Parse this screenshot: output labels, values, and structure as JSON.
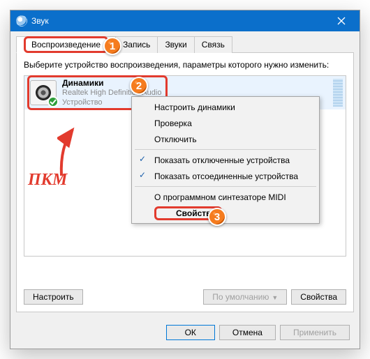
{
  "window": {
    "title": "Звук"
  },
  "tabs": {
    "playback": "Воспроизведение",
    "recording": "Запись",
    "sounds": "Звуки",
    "comm": "Связь"
  },
  "instruction": "Выберите устройство воспроизведения, параметры которого нужно изменить:",
  "device": {
    "name": "Динамики",
    "driver": "Realtek High Definition Audio",
    "status": "Устройство"
  },
  "context_menu": {
    "configure": "Настроить динамики",
    "test": "Проверка",
    "disable": "Отключить",
    "show_disabled": "Показать отключенные устройства",
    "show_disconnected": "Показать отсоединенные устройства",
    "about_midi": "О программном синтезаторе MIDI",
    "properties": "Свойства"
  },
  "buttons": {
    "configure": "Настроить",
    "set_default": "По умолчанию",
    "properties": "Свойства",
    "ok": "ОК",
    "cancel": "Отмена",
    "apply": "Применить"
  },
  "annotation": {
    "rmb": "ПКМ",
    "n1": "1",
    "n2": "2",
    "n3": "3"
  }
}
